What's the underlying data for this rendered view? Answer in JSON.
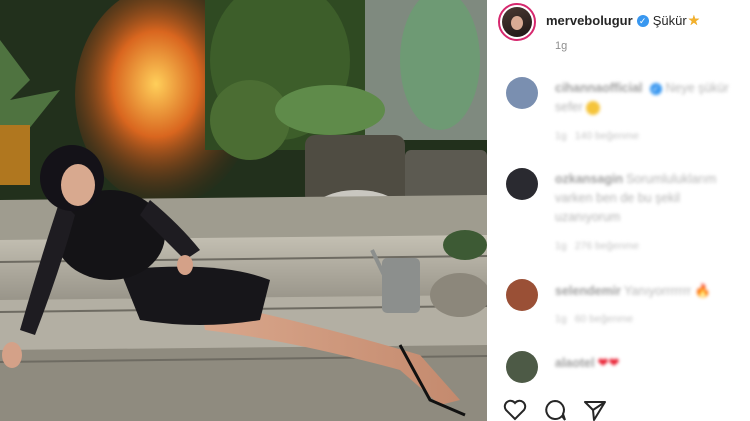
{
  "post": {
    "username": "mervebolugur",
    "caption": "Şükür",
    "caption_emoji": "star-emoji",
    "age": "1g",
    "accent_color": "#3897f0",
    "story_ring_color": "#d6286e"
  },
  "comments": [
    {
      "username": "cihannaofficial",
      "text": "Neye şükür sefer",
      "emoji": "laughing-emoji",
      "age": "1g",
      "likes": "140 beğenme",
      "avatar_color": "#7a8fb0"
    },
    {
      "username": "ozkansagin",
      "text": "Sorumluluklarım varken ben de bu şekil uzanıyorum",
      "age": "1g",
      "likes": "276 beğenme",
      "avatar_color": "#2a2a30"
    },
    {
      "username": "selendemir",
      "text": "Yanıyorrrrrrr",
      "emoji": "fire-emoji",
      "age": "1g",
      "likes": "60 beğenme",
      "avatar_color": "#9a5036"
    },
    {
      "username": "alaotel",
      "text": "",
      "emoji": "heart-emoji",
      "avatar_color": "#4d5a46"
    }
  ],
  "actions": [
    "heart-icon",
    "comment-icon",
    "share-icon"
  ]
}
